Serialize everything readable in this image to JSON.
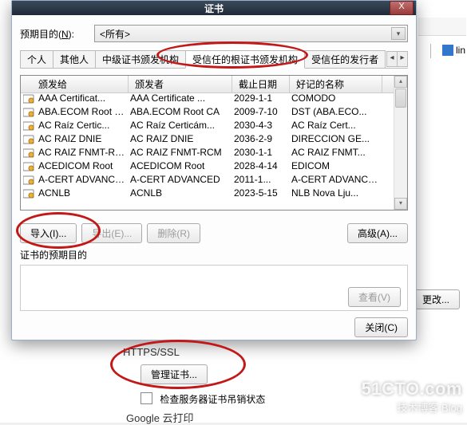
{
  "dialog": {
    "title": "证书",
    "close_x": "X",
    "purpose_label_pre": "预期目的(",
    "purpose_label_u": "N",
    "purpose_label_post": "):",
    "purpose_value": "<所有>",
    "tabs": [
      "个人",
      "其他人",
      "中级证书颁发机构",
      "受信任的根证书颁发机构",
      "受信任的发行者"
    ],
    "active_tab_index": 3,
    "columns": [
      "颁发给",
      "颁发者",
      "截止日期",
      "好记的名称"
    ],
    "rows": [
      {
        "issued_to": "AAA Certificat...",
        "issuer": "AAA Certificate ...",
        "expires": "2029-1-1",
        "friendly": "COMODO"
      },
      {
        "issued_to": "ABA.ECOM Root CA",
        "issuer": "ABA.ECOM Root CA",
        "expires": "2009-7-10",
        "friendly": "DST (ABA.ECO..."
      },
      {
        "issued_to": "AC Raíz Certic...",
        "issuer": "AC Raíz Certicám...",
        "expires": "2030-4-3",
        "friendly": "AC Raíz Cert..."
      },
      {
        "issued_to": "AC RAIZ DNIE",
        "issuer": "AC RAIZ DNIE",
        "expires": "2036-2-9",
        "friendly": "DIRECCION GE..."
      },
      {
        "issued_to": "AC RAIZ FNMT-RCM",
        "issuer": "AC RAIZ FNMT-RCM",
        "expires": "2030-1-1",
        "friendly": "AC RAIZ FNMT..."
      },
      {
        "issued_to": "ACEDICOM Root",
        "issuer": "ACEDICOM Root",
        "expires": "2028-4-14",
        "friendly": "EDICOM"
      },
      {
        "issued_to": "A-CERT ADVANCED",
        "issuer": "A-CERT ADVANCED",
        "expires": "2011-1...",
        "friendly": "A-CERT ADVANCED"
      },
      {
        "issued_to": "ACNLB",
        "issuer": "ACNLB",
        "expires": "2023-5-15",
        "friendly": "NLB Nova Lju..."
      }
    ],
    "btn_import": "导入(I)...",
    "btn_export": "导出(E)...",
    "btn_remove": "删除(R)",
    "btn_advanced": "高级(A)...",
    "intended_section_label": "证书的预期目的",
    "btn_view": "查看(V)",
    "btn_close": "关闭(C)"
  },
  "bg": {
    "section_title": "HTTPS/SSL",
    "manage_certs": "管理证书...",
    "check_revocation": "检查服务器证书吊销状态",
    "change_btn": "更改...",
    "google_print": "Google 云打印",
    "ext_tab_label": "lin"
  },
  "watermark": {
    "line1": "51CTO.com",
    "line2": "技术博客   Blog"
  }
}
